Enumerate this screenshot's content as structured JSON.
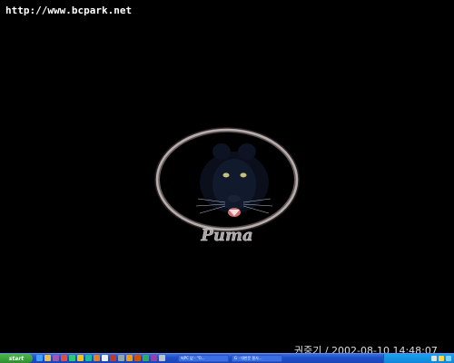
{
  "desktop": {
    "url_text": "http://www.bcpark.net",
    "wallpaper_logo_text": "Puma",
    "credit_text": "권중기 / 2002-08-10 14:48:07"
  },
  "taskbar": {
    "start_label": "start",
    "quick_launch_icons": [
      "internet-explorer-icon",
      "folder-icon",
      "media-icon",
      "app-icon",
      "app-icon",
      "app-icon",
      "app-icon",
      "app-icon",
      "app-icon",
      "app-icon",
      "app-icon",
      "app-icon",
      "app-icon",
      "app-icon",
      "app-icon",
      "app-icon"
    ],
    "task_buttons": [
      {
        "label": "써PC 없 - \"O..."
      },
      {
        "label": "G - 대한문 필사..."
      }
    ],
    "accent_color": "#245edb"
  }
}
